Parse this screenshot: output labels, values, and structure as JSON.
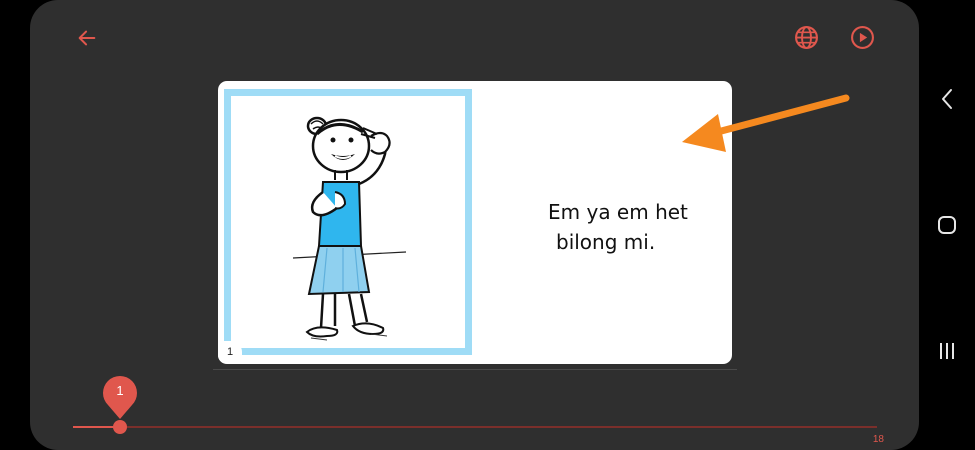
{
  "book_page": {
    "page_number": "1",
    "text_line1": "Em ya em het",
    "text_line2": "bilong mi."
  },
  "slider": {
    "current_value": "1",
    "max_label": "18",
    "current": 1,
    "max": 18
  },
  "colors": {
    "accent": "#e0574d",
    "background": "#2f2f2f",
    "frame_border": "#9fdcf6",
    "annotation_arrow": "#f5891f"
  },
  "icons": {
    "back": "arrow-left-icon",
    "language": "globe-icon",
    "play": "play-circle-icon",
    "system_back": "chevron-left-icon",
    "system_home": "square-home-icon",
    "system_recents": "recents-icon"
  }
}
